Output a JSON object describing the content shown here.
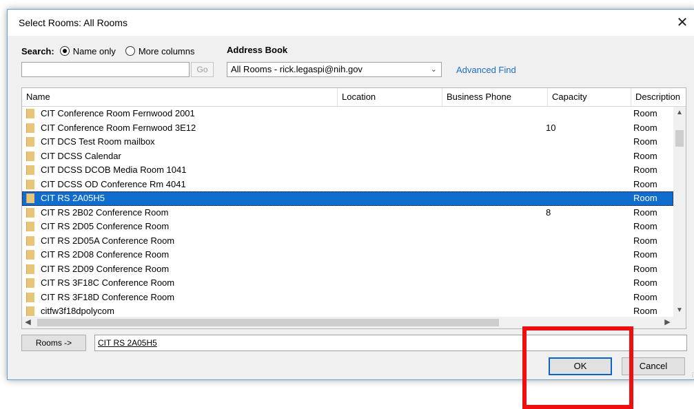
{
  "window": {
    "title": "Select Rooms: All Rooms",
    "close_glyph": "✕"
  },
  "search": {
    "label": "Search:",
    "option_name_only": "Name only",
    "option_more_columns": "More columns",
    "selected": "Name only",
    "input_value": "",
    "go_label": "Go"
  },
  "address_book": {
    "label": "Address Book",
    "selected": "All Rooms - rick.legaspi@nih.gov",
    "advanced_find": "Advanced Find"
  },
  "table": {
    "columns": [
      "Name",
      "Location",
      "Business Phone",
      "Capacity",
      "Description"
    ],
    "rows": [
      {
        "name": "CIT Conference Room Fernwood 2001",
        "capacity": "",
        "description": "Room"
      },
      {
        "name": "CIT Conference Room Fernwood 3E12",
        "capacity": "10",
        "description": "Room"
      },
      {
        "name": "CIT DCS Test Room mailbox",
        "capacity": "",
        "description": "Room"
      },
      {
        "name": "CIT DCSS Calendar",
        "capacity": "",
        "description": "Room"
      },
      {
        "name": "CIT DCSS DCOB Media Room 1041",
        "capacity": "",
        "description": "Room"
      },
      {
        "name": "CIT DCSS OD Conference Rm 4041",
        "capacity": "",
        "description": "Room"
      },
      {
        "name": "CIT RS 2A05H5",
        "capacity": "",
        "description": "Room"
      },
      {
        "name": "CIT RS 2B02 Conference Room",
        "capacity": "8",
        "description": "Room"
      },
      {
        "name": "CIT RS 2D05 Conference Room",
        "capacity": "",
        "description": "Room"
      },
      {
        "name": "CIT RS 2D05A Conference Room",
        "capacity": "",
        "description": "Room"
      },
      {
        "name": "CIT RS 2D08 Conference Room",
        "capacity": "",
        "description": "Room"
      },
      {
        "name": "CIT RS 2D09 Conference Room",
        "capacity": "",
        "description": "Room"
      },
      {
        "name": "CIT RS 3F18C Conference Room",
        "capacity": "",
        "description": "Room"
      },
      {
        "name": "CIT RS 3F18D Conference Room",
        "capacity": "",
        "description": "Room"
      },
      {
        "name": "citfw3f18dpolycom",
        "capacity": "",
        "description": "Room"
      }
    ],
    "selected_row": "CIT RS 2A05H5"
  },
  "footer": {
    "rooms_button": "Rooms ->",
    "rooms_value": "CIT RS 2A05H5",
    "ok": "OK",
    "cancel": "Cancel"
  },
  "colors": {
    "selection": "#0f6ecd",
    "link": "#1a6ec9",
    "highlight_annotation": "#ee1010"
  }
}
